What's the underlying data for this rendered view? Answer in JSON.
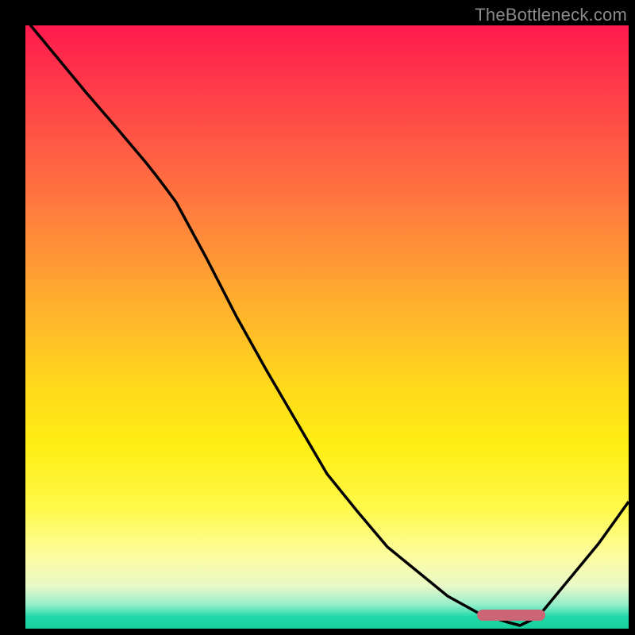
{
  "watermark": "TheBottleneck.com",
  "chart_data": {
    "type": "line",
    "title": "",
    "xlabel": "",
    "ylabel": "",
    "xlim": [
      0,
      100
    ],
    "ylim": [
      0,
      100
    ],
    "x": [
      0,
      5,
      10,
      15,
      20,
      25,
      30,
      35,
      40,
      45,
      50,
      55,
      60,
      65,
      70,
      75,
      80,
      82,
      85,
      90,
      95,
      100
    ],
    "values": [
      101,
      95,
      89,
      83,
      77,
      71,
      62,
      52,
      43,
      34,
      25,
      19,
      14,
      10,
      6,
      3,
      1,
      0.5,
      2,
      8,
      14,
      21
    ],
    "marker_band": {
      "x_start": 75,
      "x_end": 86,
      "y": 1.5
    },
    "gradient_stops": [
      {
        "pct": 0,
        "color": "#ff1a4d"
      },
      {
        "pct": 50,
        "color": "#ffda1a"
      },
      {
        "pct": 88,
        "color": "#fdfda0"
      },
      {
        "pct": 100,
        "color": "#17ce9c"
      }
    ],
    "grid": false,
    "legend": false
  }
}
